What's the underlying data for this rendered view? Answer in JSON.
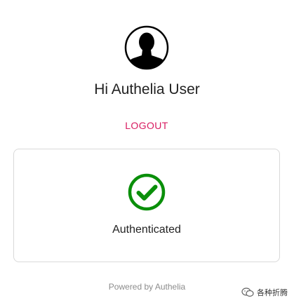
{
  "user": {
    "greeting": "Hi Authelia User",
    "avatar_icon": "user-silhouette-icon"
  },
  "actions": {
    "logout_label": "LOGOUT"
  },
  "status_card": {
    "icon": "check-circle-icon",
    "status_text": "Authenticated",
    "accent_color": "#0a8f0a"
  },
  "footer": {
    "text": "Powered by Authelia"
  },
  "watermark": {
    "icon": "chat-bubbles-icon",
    "text": "各种折腾"
  },
  "colors": {
    "logout": "#d81b60",
    "card_border": "#d9d9d9",
    "footer_text": "#8c8c8c"
  }
}
